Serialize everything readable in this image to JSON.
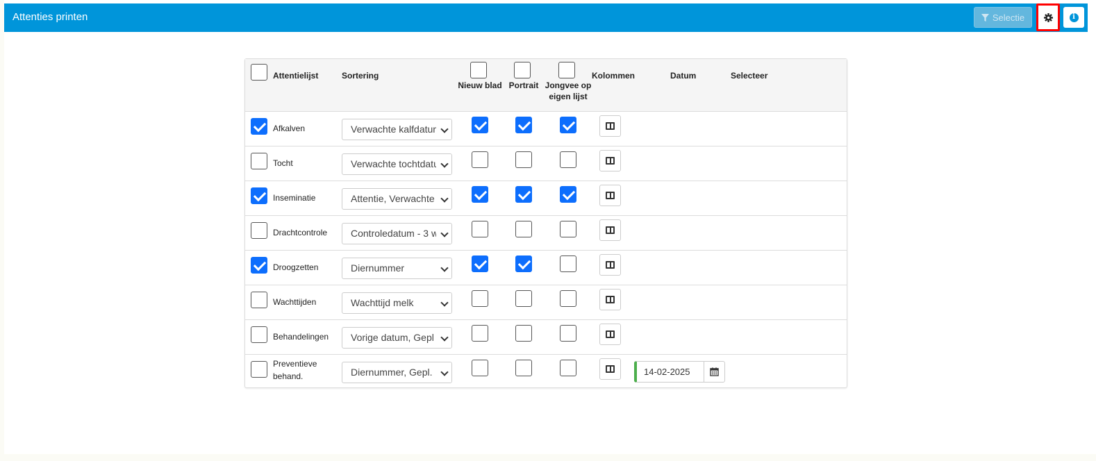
{
  "header": {
    "title": "Attenties printen",
    "selectie_label": "Selectie",
    "colors": {
      "bar": "#0095da",
      "highlight": "#ff0000"
    }
  },
  "table": {
    "columns": {
      "attentielijst": "Attentielijst",
      "sortering": "Sortering",
      "nieuw_blad": "Nieuw blad",
      "portrait": "Portrait",
      "jongvee_line1": "Jongvee op",
      "jongvee_line2": "eigen lijst",
      "kolommen": "Kolommen",
      "datum": "Datum",
      "selecteer": "Selecteer"
    },
    "rows": [
      {
        "label": "Afkalven",
        "label2": "",
        "checked": true,
        "sort": "Verwachte kalfdatum",
        "nieuw_blad": true,
        "portrait": true,
        "jongvee": true
      },
      {
        "label": "Tocht",
        "label2": "",
        "checked": false,
        "sort": "Verwachte tochtdatum",
        "nieuw_blad": false,
        "portrait": false,
        "jongvee": false
      },
      {
        "label": "Inseminatie",
        "label2": "",
        "checked": true,
        "sort": "Attentie, Verwachte",
        "nieuw_blad": true,
        "portrait": true,
        "jongvee": true
      },
      {
        "label": "Drachtcontrole",
        "label2": "",
        "checked": false,
        "sort": "Controledatum - 3 w",
        "nieuw_blad": false,
        "portrait": false,
        "jongvee": false
      },
      {
        "label": "Droogzetten",
        "label2": "",
        "checked": true,
        "sort": "Diernummer",
        "nieuw_blad": true,
        "portrait": true,
        "jongvee": false
      },
      {
        "label": "Wachttijden",
        "label2": "",
        "checked": false,
        "sort": "Wachttijd melk",
        "nieuw_blad": false,
        "portrait": false,
        "jongvee": false
      },
      {
        "label": "Behandelingen",
        "label2": "",
        "checked": false,
        "sort": "Vorige datum, Gepl",
        "nieuw_blad": false,
        "portrait": false,
        "jongvee": false
      },
      {
        "label": "Preventieve",
        "label2": "behand.",
        "checked": false,
        "sort": "Diernummer, Gepl.",
        "nieuw_blad": false,
        "portrait": false,
        "jongvee": false,
        "datum": "14-02-2025"
      }
    ]
  },
  "icons": {
    "filter": "filter-icon",
    "settings": "gear-icon",
    "info": "info-icon",
    "columns": "columns-icon",
    "calendar": "calendar-icon"
  }
}
